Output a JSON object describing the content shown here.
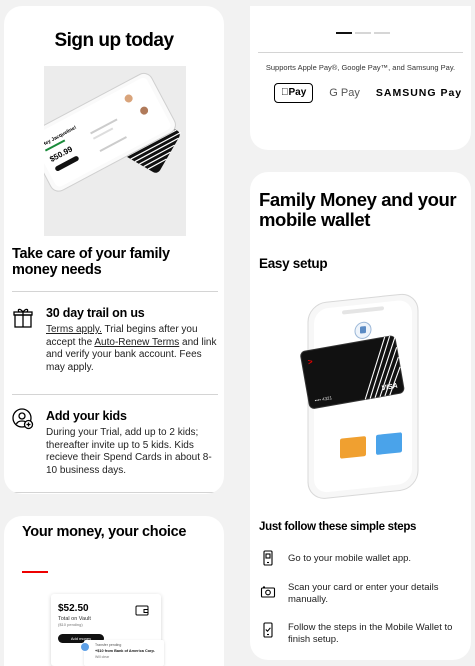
{
  "signup_card": {
    "title": "Sign up today",
    "subtitle": "Take care of your family money needs",
    "hero_phone": {
      "header": "Hey Jacqueline!",
      "balance": "$50.99"
    },
    "features": [
      {
        "icon": "gift-icon",
        "title": "30 day trail on us",
        "body_parts": [
          {
            "text": "Terms apply.",
            "link": true
          },
          {
            "text": " Trial begins after you accept the ",
            "link": false
          },
          {
            "text": "Auto-Renew Terms",
            "link": true
          },
          {
            "text": " and link and verify your bank account. Fees may apply.",
            "link": false
          }
        ]
      },
      {
        "icon": "add-kid-icon",
        "title": "Add your kids",
        "body": "During your Trial, add up to 2 kids; thereafter invite up to 5 kids. Kids recieve their Spend Cards in about 8-10 business days."
      }
    ]
  },
  "pay_card": {
    "carousel_dots": 3,
    "active_dot": 0,
    "supports_text": "Supports Apple Pay®, Google Pay™, and Samsung Pay.",
    "apple_pay": "Pay",
    "google_pay": "G Pay",
    "samsung_pay": "SAMSUNG Pay"
  },
  "wallet_card": {
    "title": "Family Money and your mobile wallet",
    "subheading": "Easy setup",
    "card_brand": "VISA",
    "card_number": "•••• 4321",
    "steps_title": "Just follow these simple steps",
    "steps": [
      {
        "icon": "phone-icon",
        "text": "Go to your mobile wallet app."
      },
      {
        "icon": "camera-scan-icon",
        "text": "Scan your card or enter your details manually."
      },
      {
        "icon": "phone-check-icon",
        "text": "Follow the steps in the Mobile Wallet to finish setup."
      }
    ]
  },
  "choice_card": {
    "title": "Your money, your choice",
    "vault_amount": "$52.50",
    "vault_label": "Total on Vault",
    "vault_sub": "($10 pending)",
    "add_money": "Add money",
    "txn_title": "Transfer pending",
    "txn_desc": "+$10 from Bank of America Corp.",
    "txn_sub": "Will clear"
  },
  "colors": {
    "accent": "#ee0000",
    "text": "#000000",
    "background": "#f2f2f2"
  }
}
